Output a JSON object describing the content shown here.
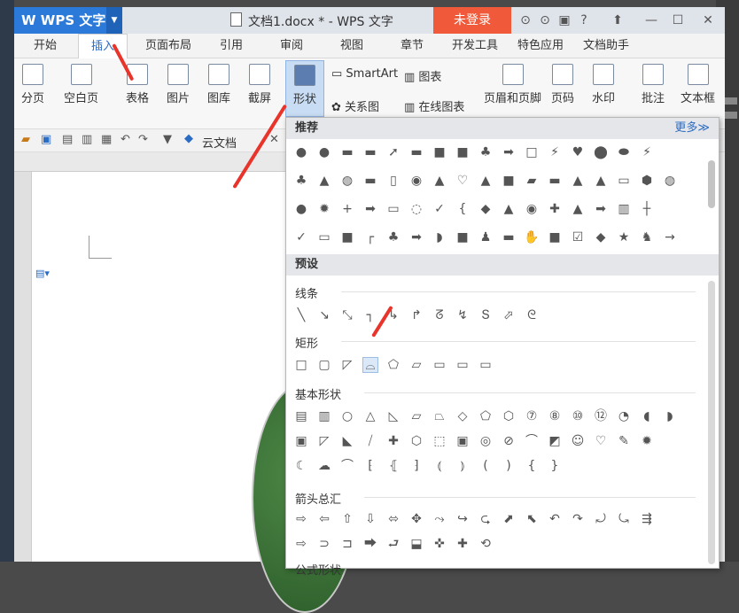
{
  "app": {
    "name": "WPS 文字",
    "doc_title": "文档1.docx * - WPS 文字",
    "login": "未登录"
  },
  "menubar": [
    "开始",
    "插入",
    "页面布局",
    "引用",
    "审阅",
    "视图",
    "章节",
    "开发工具",
    "特色应用",
    "文档助手"
  ],
  "ribbon": {
    "paging": "分页",
    "blank": "空白页",
    "table": "表格",
    "picture": "图片",
    "gallery": "图库",
    "screenshot": "截屏",
    "shapes": "形状",
    "smartart": "SmartArt",
    "chart": "图表",
    "relation": "关系图",
    "online_chart": "在线图表",
    "header_footer": "页眉和页脚",
    "page_num": "页码",
    "watermark": "水印",
    "comment": "批注",
    "textbox": "文本框"
  },
  "quickbar": {
    "cloud": "云文档"
  },
  "panel": {
    "recommend": "推荐",
    "more": "更多≫",
    "preset": "预设",
    "lines": "线条",
    "rect": "矩形",
    "basic": "基本形状",
    "arrows": "箭头总汇",
    "formula": "公式形状"
  },
  "icons": {
    "rec_row1": [
      "●",
      "●",
      "▬",
      "▬",
      "➚",
      "▬",
      "■",
      "■",
      "♣",
      "➡",
      "□",
      "⚡",
      "♥",
      "⬤",
      "⬬",
      "⚡"
    ],
    "rec_row2": [
      "♣",
      "▲",
      "◍",
      "▬",
      "▯",
      "◉",
      "▲",
      "♡",
      "▲",
      "■",
      "▰",
      "▬",
      "▲",
      "▲",
      "▭",
      "⬢",
      "◍"
    ],
    "rec_row3": [
      "●",
      "✹",
      "+",
      "➡",
      "▭",
      "◌",
      "✓",
      "{",
      "◆",
      "▲",
      "◉",
      "✚",
      "▲",
      "➡",
      "▥",
      "┼"
    ],
    "rec_row4": [
      "✓",
      "▭",
      "■",
      "┌",
      "♣",
      "➡",
      "◗",
      "■",
      "♟",
      "▬",
      "✋",
      "■",
      "☑",
      "◆",
      "★",
      "♞",
      "→"
    ],
    "lines": [
      "╲",
      "↘",
      "⤡",
      "┐",
      "↳",
      "↱",
      "ᘔ",
      "↯",
      "Տ",
      "⬀",
      "ᘓ"
    ],
    "rects": [
      "□",
      "▢",
      "◸",
      "⌓",
      "⬠",
      "▱",
      "▭",
      "▭",
      "▭"
    ],
    "basic1": [
      "▤",
      "▥",
      "○",
      "△",
      "◺",
      "▱",
      "⏢",
      "◇",
      "⬠",
      "⬡",
      "⑦",
      "⑧",
      "⑩",
      "⑫",
      "◔",
      "◖",
      "◗"
    ],
    "basic2": [
      "▣",
      "◸",
      "◣",
      "⧸",
      "✚",
      "⬡",
      "⬚",
      "▣",
      "◎",
      "⊘",
      "⌒",
      "◩",
      "☺",
      "♡",
      "✎",
      "✹"
    ],
    "basic3": [
      "☾",
      "☁",
      "⌒",
      "⁅",
      "⦃",
      "⁆",
      "⦅",
      "⦆",
      "(",
      ")",
      "{",
      "}"
    ],
    "arrows1": [
      "⇨",
      "⇦",
      "⇧",
      "⇩",
      "⬄",
      "✥",
      "⤳",
      "↪",
      "⮎",
      "⬈",
      "⬉",
      "↶",
      "↷",
      "⤾",
      "⤿",
      "⇶"
    ],
    "arrows2": [
      "⇨",
      "⊃",
      "⊐",
      "⮕",
      "⮐",
      "⬓",
      "✜",
      "✚",
      "⟲"
    ]
  }
}
